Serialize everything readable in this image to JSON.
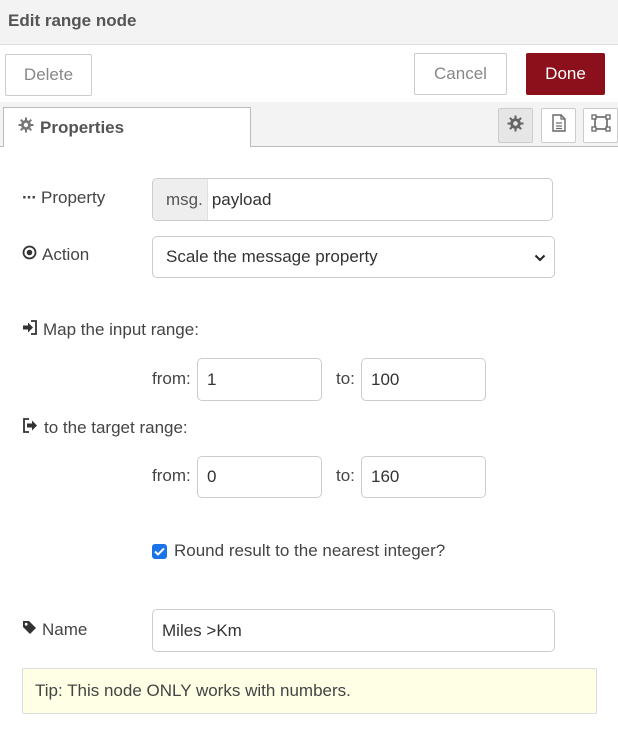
{
  "header": {
    "title": "Edit range node"
  },
  "toolbar": {
    "delete_label": "Delete",
    "cancel_label": "Cancel",
    "done_label": "Done"
  },
  "tabs": {
    "properties_label": "Properties"
  },
  "form": {
    "property": {
      "label": "Property",
      "prefix": "msg.",
      "value": "payload"
    },
    "action": {
      "label": "Action",
      "selected": "Scale the message property"
    },
    "input_range": {
      "label": "Map the input range:",
      "from_label": "from:",
      "from_value": "1",
      "to_label": "to:",
      "to_value": "100"
    },
    "target_range": {
      "label": "to the target range:",
      "from_label": "from:",
      "from_value": "0",
      "to_label": "to:",
      "to_value": "160"
    },
    "round": {
      "label": "Round result to the nearest integer?",
      "checked": true
    },
    "name": {
      "label": "Name",
      "value": "Miles >Km"
    }
  },
  "tip": {
    "text": "Tip: This node ONLY works with numbers."
  },
  "colors": {
    "accent": "#8c101c",
    "checkbox": "#1a73e8",
    "tip_bg": "#ffffe6"
  }
}
